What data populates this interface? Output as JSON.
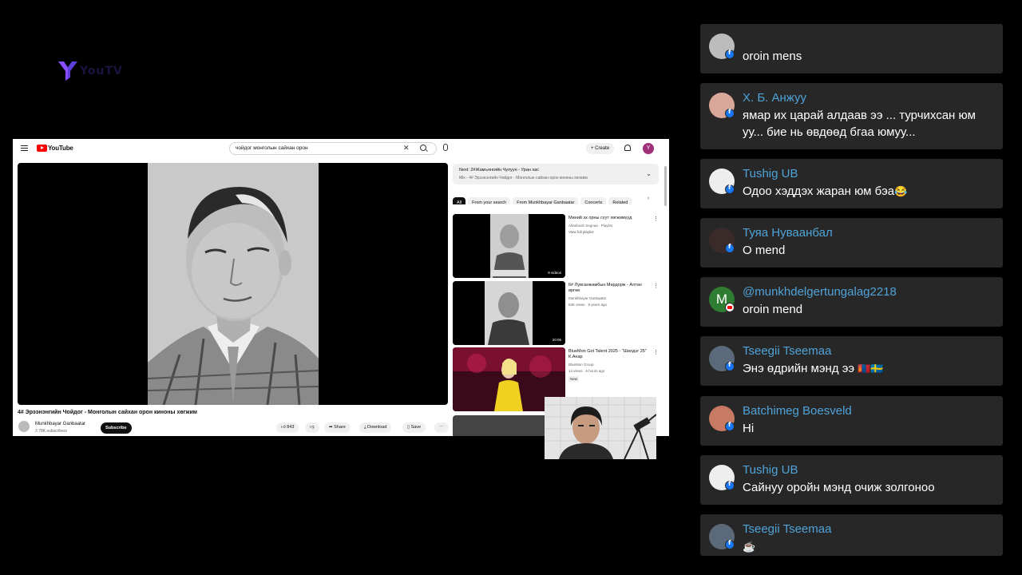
{
  "overlay": {
    "brand_text": "YouTV"
  },
  "youtube": {
    "search_value": "чойдог монголын сайхан орон",
    "create_label": "Create",
    "avatar_letter": "Y",
    "video_title": "4# Эрээнэнгийн Чойдог - Монголын сайхан орон киноны хөгжим",
    "channel_name": "Munkhbayar Ganbaatar",
    "channel_subs": "2.78K subscribers",
    "subscribe_label": "Subscribe",
    "like_count": "843",
    "share_label": "Share",
    "download_label": "Download",
    "save_label": "Save",
    "next_title": "Next: 2#Жамъянгийн Чулуун - Уран хас",
    "next_sub": "Mix - 4# Эрээнэнгийн Чойдог - Монголын сайхан орон киноны хөгжим",
    "chips": [
      "All",
      "From your search",
      "From Munkhbayar Ganbaatar",
      "Concerts",
      "Related"
    ],
    "recommendations": [
      {
        "title": "Миний эх орны сүүт хөгжимүүд",
        "channel": "Altanbush Segnaa · Playlist",
        "meta": "View full playlist",
        "badge": "9 videos"
      },
      {
        "title": "6# Лувсанжамбын Мөрдорж - Алтан өргөө",
        "channel": "Munkhbayar Ganbaatar",
        "meta": "63K views · 9 years ago",
        "badge": "20:05"
      },
      {
        "title": "BlueMon Got Talent 2025 - \"Шилдэг 25\" К.Анар",
        "channel": "BlueMon Group",
        "meta": "14 views · 6 hours ago",
        "badge_new": "New"
      }
    ]
  },
  "chat": {
    "messages": [
      {
        "name": "",
        "text": "oroin mens",
        "platform": "facebook",
        "avatar_color": "#bcbcbc"
      },
      {
        "name": "Х. Б. Анжуу",
        "text": "ямар их царай алдаав ээ ... турчихсан юм уу... бие нь өвдөөд бгаа юмуу...",
        "platform": "facebook",
        "avatar_color": "#d9a79a"
      },
      {
        "name": "Tushig UB",
        "text": "Одоо хэддэх жаран юм бэа",
        "emoji": "😂",
        "platform": "facebook",
        "avatar_color": "#eeeeee"
      },
      {
        "name": "Туяа Нуваанбал",
        "text": "О mend",
        "platform": "facebook",
        "avatar_color": "#3a2a2a"
      },
      {
        "name": "@munkhdelgertungalag2218",
        "text": "oroin mend",
        "platform": "youtube",
        "avatar_color": "#2e7d32",
        "avatar_letter": "M"
      },
      {
        "name": "Tseegii Tseemaa",
        "text": "Энэ өдрийн мэнд ээ",
        "emoji": "🇲🇳🇸🇪",
        "platform": "facebook",
        "avatar_color": "#5b6a7a"
      },
      {
        "name": "Batchimeg Boesveld",
        "text": "Hi",
        "platform": "facebook",
        "avatar_color": "#c97a62"
      },
      {
        "name": "Tushig UB",
        "text": "Сайнуу оройн мэнд очиж золгоноо",
        "platform": "facebook",
        "avatar_color": "#eeeeee"
      },
      {
        "name": "Tseegii Tseemaa",
        "text": "",
        "emoji": "☕",
        "platform": "facebook",
        "avatar_color": "#5b6a7a"
      }
    ]
  }
}
